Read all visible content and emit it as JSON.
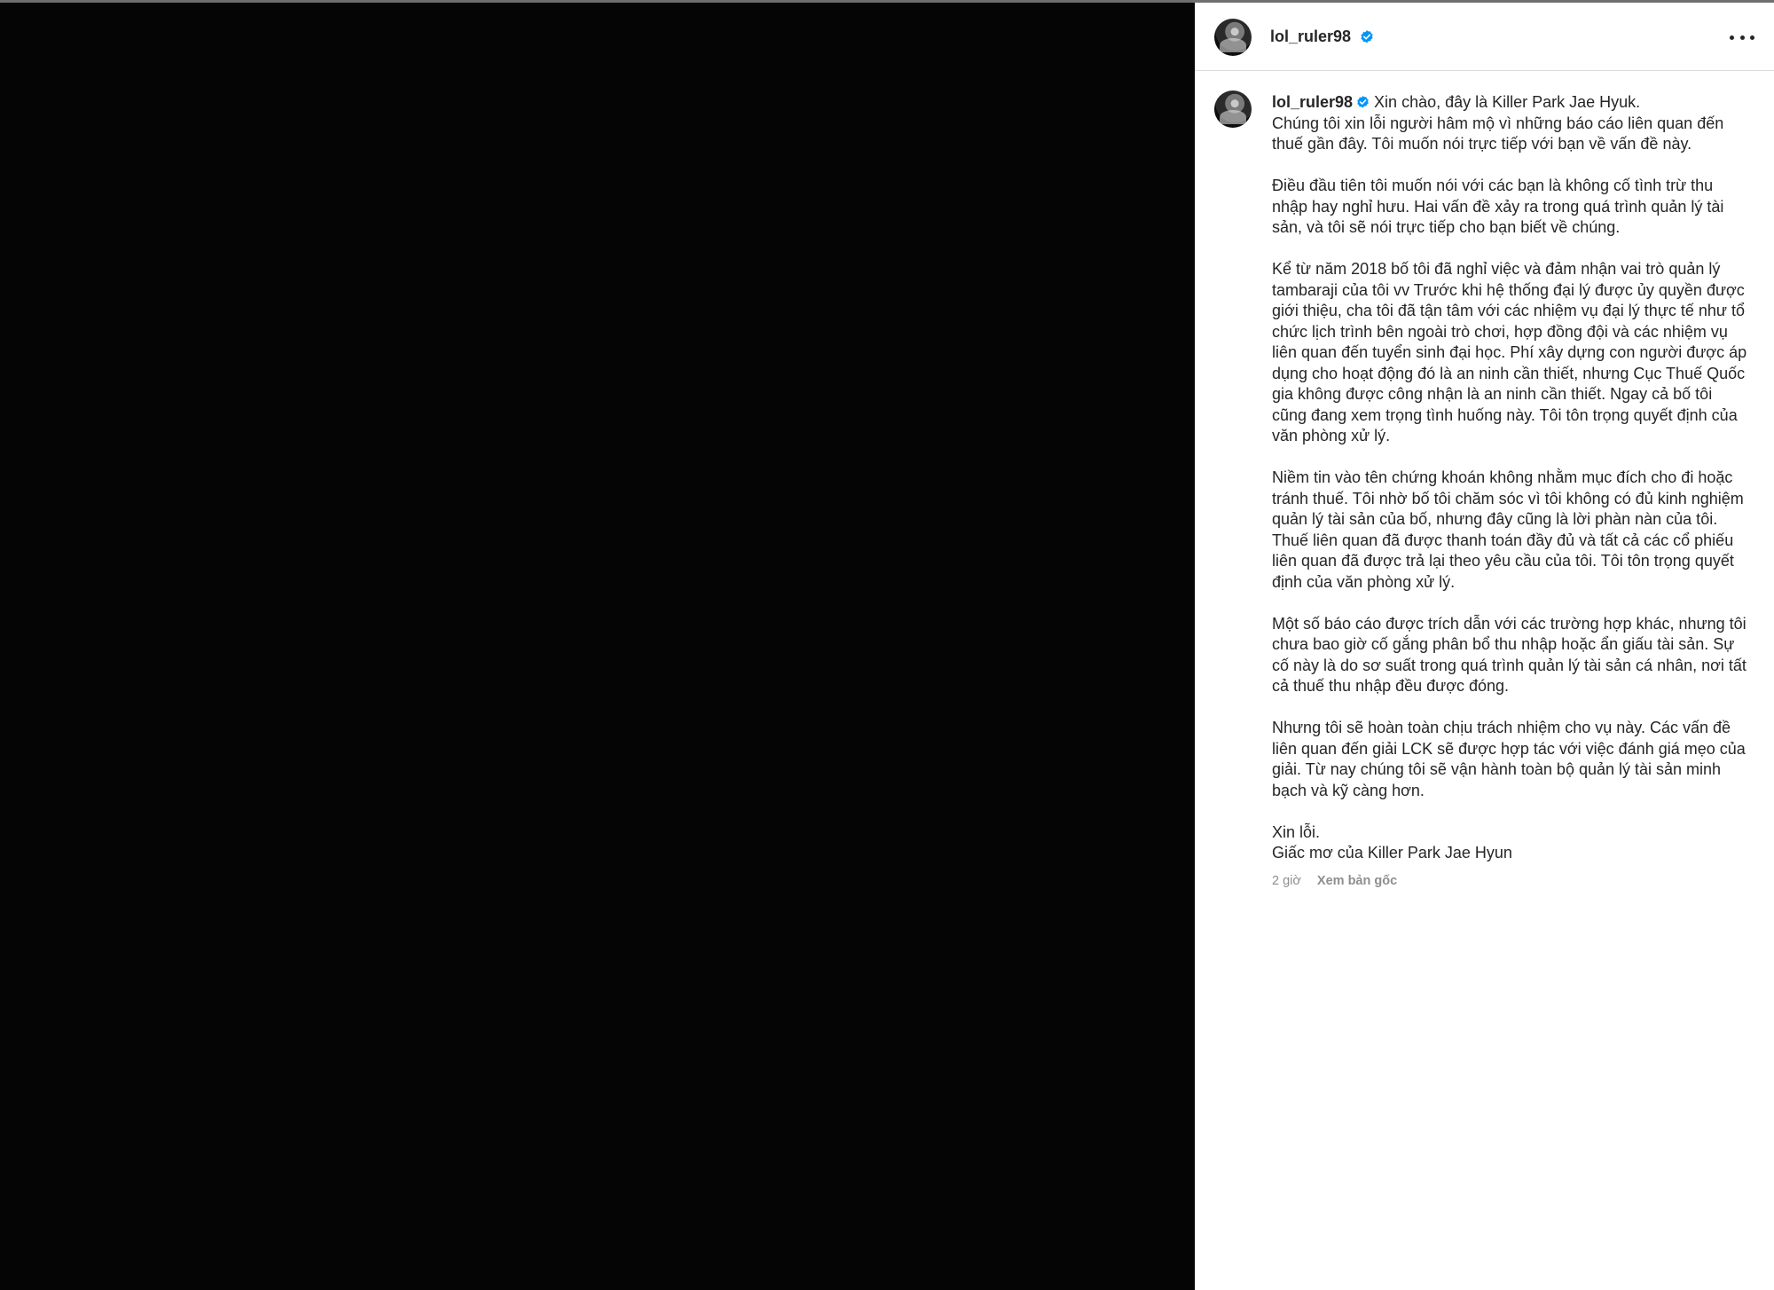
{
  "header": {
    "username": "lol_ruler98",
    "verified_icon": "verified-badge-icon",
    "more_icon": "more-options-icon"
  },
  "caption": {
    "username": "lol_ruler98",
    "first_line": "Xin chào, đây là Killer Park Jae Hyuk.",
    "para1_rest": "Chúng tôi xin lỗi người hâm mộ vì những báo cáo liên quan đến thuế gần đây. Tôi muốn nói trực tiếp với bạn về vấn đề này.",
    "para2": "Điều đầu tiên tôi muốn nói với các bạn là không cố tình trừ thu nhập hay nghỉ hưu. Hai vấn đề xảy ra trong quá trình quản lý tài sản, và tôi sẽ nói trực tiếp cho bạn biết về chúng.",
    "para3": "Kể từ năm 2018 bố tôi đã nghỉ việc và đảm nhận vai trò quản lý tambaraji của tôi vv Trước khi hệ thống đại lý được ủy quyền được giới thiệu, cha tôi đã tận tâm với các nhiệm vụ đại lý thực tế như tổ chức lịch trình bên ngoài trò chơi, hợp đồng đội và các nhiệm vụ liên quan đến tuyển sinh đại học. Phí xây dựng con người được áp dụng cho hoạt động đó là an ninh cần thiết, nhưng Cục Thuế Quốc gia không được công nhận là an ninh cần thiết. Ngay cả bố tôi cũng đang xem trọng tình huống này. Tôi tôn trọng quyết định của văn phòng xử lý.",
    "para4": "Niềm tin vào tên chứng khoán không nhằm mục đích cho đi hoặc tránh thuế. Tôi nhờ bố tôi chăm sóc vì tôi không có đủ kinh nghiệm quản lý tài sản của bố, nhưng đây cũng là lời phàn nàn của tôi. Thuế liên quan đã được thanh toán đầy đủ và tất cả các cổ phiếu liên quan đã được trả lại theo yêu cầu của tôi. Tôi tôn trọng quyết định của văn phòng xử lý.",
    "para5": "Một số báo cáo được trích dẫn với các trường hợp khác, nhưng tôi chưa bao giờ cố gắng phân bổ thu nhập hoặc ẩn giấu tài sản. Sự cố này là do sơ suất trong quá trình quản lý tài sản cá nhân, nơi tất cả thuế thu nhập đều được đóng.",
    "para6": "Nhưng tôi sẽ hoàn toàn chịu trách nhiệm cho vụ này. Các vấn đề liên quan đến giải LCK sẽ được hợp tác với việc đánh giá mẹo của giải. Từ nay chúng tôi sẽ vận hành toàn bộ quản lý tài sản minh bạch và kỹ càng hơn.",
    "closing1": "Xin lỗi.",
    "closing2": "Giấc mơ của Killer Park Jae Hyun",
    "time": "2 giờ",
    "see_original": "Xem bản gốc"
  },
  "colors": {
    "media_bg": "#050505",
    "panel_bg": "#ffffff",
    "text": "#262626",
    "meta": "#8e8e8e",
    "verified": "#0095f6"
  }
}
